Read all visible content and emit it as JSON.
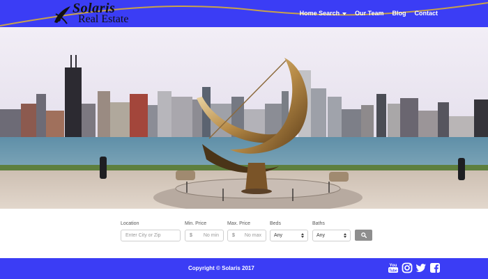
{
  "brand": {
    "title": "Solaris",
    "subtitle": "Real Estate"
  },
  "nav": {
    "items": [
      {
        "label": "Home Search",
        "has_dropdown": true
      },
      {
        "label": "Our Team",
        "has_dropdown": false
      },
      {
        "label": "Blog",
        "has_dropdown": false
      },
      {
        "label": "Contact",
        "has_dropdown": false
      }
    ]
  },
  "search": {
    "location": {
      "label": "Location",
      "placeholder": "Enter City or Zip"
    },
    "min_price": {
      "label": "Min. Price",
      "prefix": "$",
      "placeholder": "No min"
    },
    "max_price": {
      "label": "Max. Price",
      "prefix": "$",
      "placeholder": "No max"
    },
    "beds": {
      "label": "Beds",
      "value": "Any"
    },
    "baths": {
      "label": "Baths",
      "value": "Any"
    },
    "button_icon": "search-icon"
  },
  "footer": {
    "copyright": "Copyright © Solaris 2017",
    "socials": [
      "youtube-icon",
      "instagram-icon",
      "twitter-icon",
      "facebook-icon"
    ]
  },
  "colors": {
    "brand_blue": "#3b3df5",
    "swoosh_gold": "#c9a24a",
    "button_gray": "#8e8e8e"
  }
}
